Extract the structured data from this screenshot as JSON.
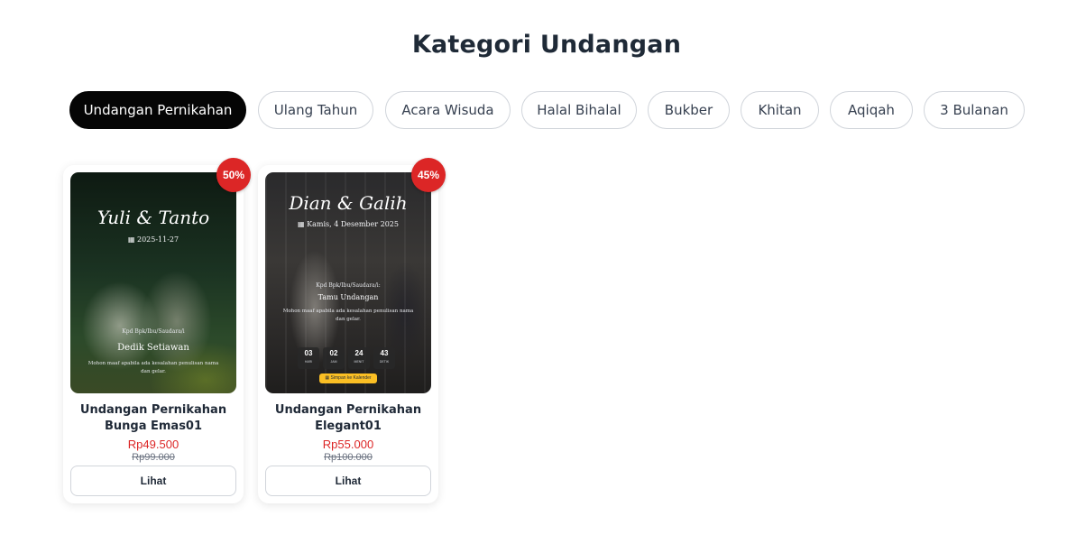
{
  "page": {
    "title": "Kategori Undangan"
  },
  "tabs": [
    {
      "label": "Undangan Pernikahan",
      "active": true
    },
    {
      "label": "Ulang Tahun",
      "active": false
    },
    {
      "label": "Acara Wisuda",
      "active": false
    },
    {
      "label": "Halal Bihalal",
      "active": false
    },
    {
      "label": "Bukber",
      "active": false
    },
    {
      "label": "Khitan",
      "active": false
    },
    {
      "label": "Aqiqah",
      "active": false
    },
    {
      "label": "3 Bulanan",
      "active": false
    }
  ],
  "products": [
    {
      "name": "Undangan Pernikahan Bunga Emas01",
      "price": "Rp49.500",
      "original_price": "Rp99.000",
      "discount": "50%",
      "view_label": "Lihat",
      "preview": {
        "couple": "Yuli & Tanto",
        "date": "2025-11-27",
        "greeting": "Kpd Bpk/Ibu/Saudara/i",
        "guest": "Dedik Setiawan",
        "note": "Mohon maaf apabila ada kesalahan penulisan nama dan gelar."
      }
    },
    {
      "name": "Undangan Pernikahan Elegant01",
      "price": "Rp55.000",
      "original_price": "Rp100.000",
      "discount": "45%",
      "view_label": "Lihat",
      "preview": {
        "couple": "Dian & Galih",
        "date": "Kamis, 4 Desember 2025",
        "greeting": "Kpd Bpk/Ibu/Saudara/i:",
        "guest": "Tamu Undangan",
        "note": "Mohon maaf apabila ada kesalahan penulisan nama dan gelar.",
        "countdown": [
          {
            "value": "03",
            "unit": "HARI"
          },
          {
            "value": "02",
            "unit": "JAM"
          },
          {
            "value": "24",
            "unit": "MENIT"
          },
          {
            "value": "43",
            "unit": "DETIK"
          }
        ],
        "calendar_label": "Simpan ke Kalender"
      }
    }
  ],
  "colors": {
    "accent": "#dc2626",
    "active_tab": "#050505",
    "calendar_button": "#fbbf24"
  }
}
